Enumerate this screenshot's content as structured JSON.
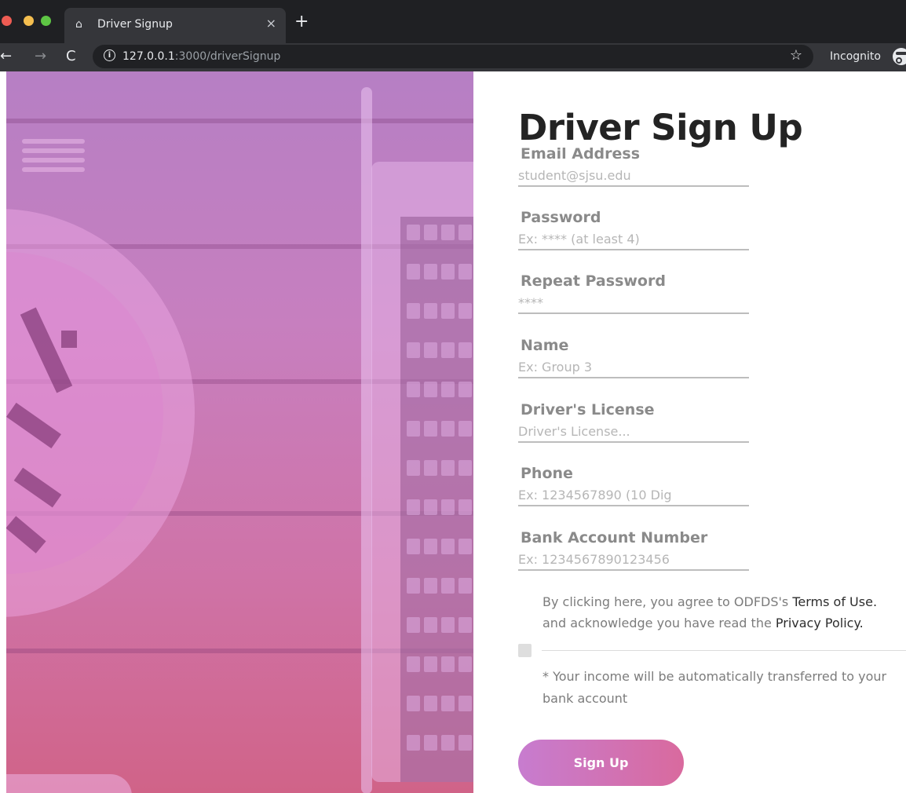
{
  "browser": {
    "tab_title": "Driver Signup",
    "tab_close": "×",
    "new_tab": "+",
    "back": "←",
    "forward": "→",
    "reload": "C",
    "url_host": "127.0.0.1",
    "url_path": ":3000/driverSignup",
    "star": "☆",
    "incognito_label": "Incognito"
  },
  "form": {
    "title": "Driver Sign Up",
    "fields": [
      {
        "label": "Email Address",
        "placeholder": "student@sjsu.edu"
      },
      {
        "label": "Password",
        "placeholder": "Ex: **** (at least 4)"
      },
      {
        "label": "Repeat Password",
        "placeholder": "****"
      },
      {
        "label": "Name",
        "placeholder": "Ex: Group 3"
      },
      {
        "label": "Driver's License",
        "placeholder": "Driver's License..."
      },
      {
        "label": "Phone",
        "placeholder": "Ex: 1234567890 (10 Dig"
      },
      {
        "label": "Bank Account Number",
        "placeholder": "Ex: 1234567890123456"
      }
    ],
    "agree_prefix": "By clicking here, you agree to ODFDS's ",
    "terms_link": "Terms of Use.",
    "agree_middle": "and acknowledge you have read the ",
    "privacy_link": "Privacy Policy.",
    "note": "* Your income will be automatically transferred to your bank account",
    "submit_label": "Sign Up"
  },
  "colors": {
    "accent_start": "#c77ccf",
    "accent_end": "#d96a9e",
    "title": "#232323",
    "label": "#8a8a8a"
  }
}
